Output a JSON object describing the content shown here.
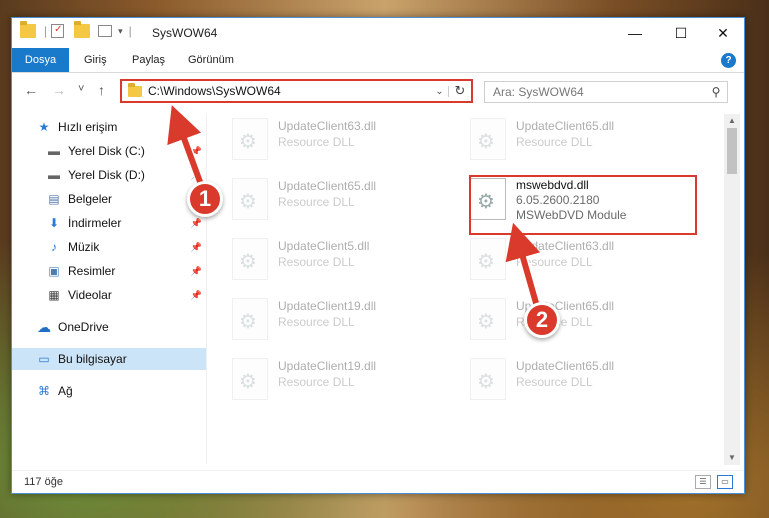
{
  "window": {
    "title": "SysWOW64",
    "minimize_glyph": "—",
    "maximize_glyph": "☐",
    "close_glyph": "✕"
  },
  "ribbon": {
    "tabs": [
      {
        "label": "Dosya",
        "active": true
      },
      {
        "label": "Giriş"
      },
      {
        "label": "Paylaş"
      },
      {
        "label": "Görünüm"
      }
    ],
    "help_label": "?"
  },
  "nav": {
    "back_glyph": "←",
    "forward_glyph": "→",
    "recent_glyph": "˅",
    "up_glyph": "↑"
  },
  "address": {
    "path": "C:\\Windows\\SysWOW64",
    "chevron_glyph": "⌄",
    "refresh_glyph": "↻"
  },
  "search": {
    "placeholder": "Ara: SysWOW64",
    "icon_glyph": "⚲"
  },
  "sidebar": {
    "items": [
      {
        "label": "Hızlı erişim",
        "icon": "star-icon",
        "glyph": "★"
      },
      {
        "label": "Yerel Disk (C:)",
        "icon": "drive-icon",
        "glyph": "▬",
        "pin": "📌"
      },
      {
        "label": "Yerel Disk (D:)",
        "icon": "drive-icon",
        "glyph": "▬",
        "pin": "📌"
      },
      {
        "label": "Belgeler",
        "icon": "documents-icon",
        "glyph": "▤",
        "pin": "📌"
      },
      {
        "label": "İndirmeler",
        "icon": "download-icon",
        "glyph": "⬇",
        "pin": "📌"
      },
      {
        "label": "Müzik",
        "icon": "music-icon",
        "glyph": "♪",
        "pin": "📌"
      },
      {
        "label": "Resimler",
        "icon": "pictures-icon",
        "glyph": "▣",
        "pin": "📌"
      },
      {
        "label": "Videolar",
        "icon": "videos-icon",
        "glyph": "▦",
        "pin": "📌"
      },
      {
        "label": "OneDrive",
        "icon": "cloud-icon",
        "glyph": "☁"
      },
      {
        "label": "Bu bilgisayar",
        "icon": "computer-icon",
        "glyph": "▭",
        "selected": true
      },
      {
        "label": "Ağ",
        "icon": "network-icon",
        "glyph": "⌘"
      }
    ]
  },
  "files": {
    "left": [
      {
        "name": "UpdateClient63.dll",
        "type": "Resource DLL"
      },
      {
        "name": "UpdateClient65.dll",
        "type": "Resource DLL"
      },
      {
        "name": "UpdateClient5.dll",
        "type": "Resource DLL"
      },
      {
        "name": "UpdateClient19.dll",
        "type": "Resource DLL"
      },
      {
        "name": "UpdateClient19.dll",
        "type": "Resource DLL"
      }
    ],
    "right": [
      {
        "name": "UpdateClient65.dll",
        "type": "Resource DLL"
      },
      {
        "name": "mswebdvd.dll",
        "version": "6.05.2600.2180",
        "type": "MSWebDVD Module",
        "main": true
      },
      {
        "name": "UpdateClient63.dll",
        "type": "Resource DLL"
      },
      {
        "name": "UpdateClient65.dll",
        "type": "Resource DLL"
      },
      {
        "name": "UpdateClient65.dll",
        "type": "Resource DLL"
      }
    ]
  },
  "status": {
    "count": "117 öğe"
  },
  "annotations": {
    "badge1": "1",
    "badge2": "2",
    "color": "#d93a2b"
  }
}
